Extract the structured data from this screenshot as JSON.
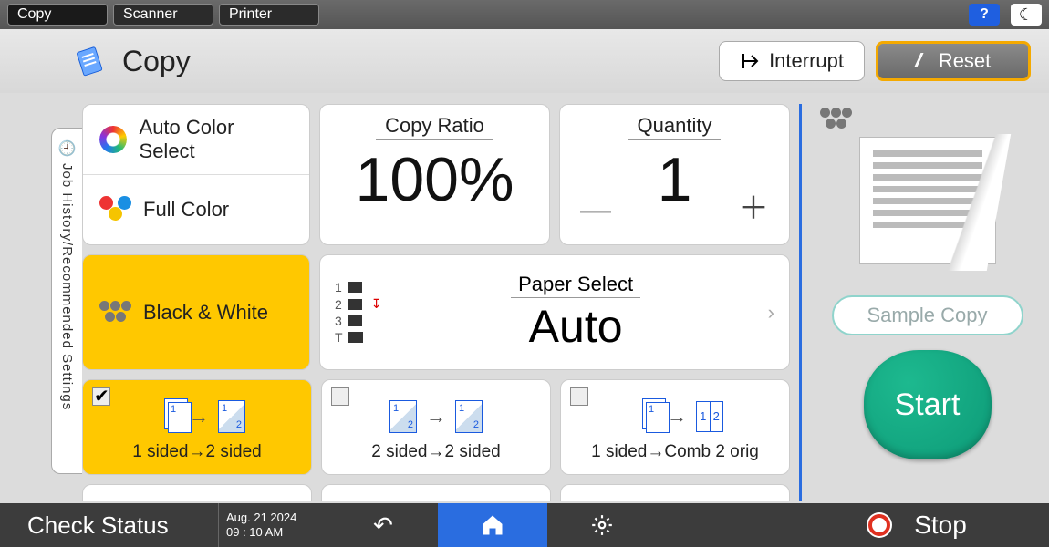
{
  "topbar": {
    "tabs": [
      "Copy",
      "Scanner",
      "Printer"
    ],
    "help": "?",
    "night": "☾"
  },
  "header": {
    "title": "Copy",
    "interrupt": "Interrupt",
    "reset": "Reset"
  },
  "sidetab": {
    "label": "Job History/Recommended Settings"
  },
  "color_modes": {
    "auto": "Auto Color Select",
    "full": "Full Color",
    "bw": "Black & White",
    "selected": "bw"
  },
  "copy_ratio": {
    "label": "Copy Ratio",
    "value": "100%"
  },
  "quantity": {
    "label": "Quantity",
    "value": "1"
  },
  "paper": {
    "label": "Paper Select",
    "value": "Auto",
    "trays": [
      "1",
      "2",
      "3",
      "T"
    ]
  },
  "duplex_options": [
    {
      "label": "1 sided→2 sided",
      "selected": true
    },
    {
      "label": "2 sided→2 sided",
      "selected": false
    },
    {
      "label": "1 sided→Comb 2 orig",
      "selected": false
    }
  ],
  "right": {
    "sample": "Sample Copy",
    "start": "Start"
  },
  "bottom": {
    "check": "Check Status",
    "date": "Aug. 21 2024",
    "time": "09 : 10 AM",
    "stop": "Stop"
  }
}
